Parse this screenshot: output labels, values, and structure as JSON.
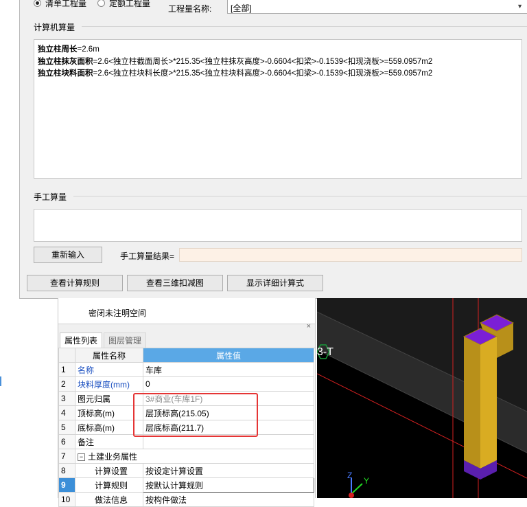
{
  "top_row": {
    "radio_bill": "清单工程量",
    "radio_quota": "定额工程量",
    "quantity_name_label": "工程量名称:",
    "quantity_name_value": "[全部]"
  },
  "computer_calc": {
    "title": "计算机算量",
    "lines": [
      {
        "bold": "独立柱周长",
        "rest": "=2.6m"
      },
      {
        "bold": "独立柱抹灰面积",
        "rest": "=2.6<独立柱截面周长>*215.35<独立柱抹灰高度>-0.6604<扣梁>-0.1539<扣现浇板>=559.0957m2"
      },
      {
        "bold": "独立柱块料面积",
        "rest": "=2.6<独立柱块料长度>*215.35<独立柱块料高度>-0.6604<扣梁>-0.1539<扣现浇板>=559.0957m2"
      }
    ]
  },
  "manual_calc": {
    "title": "手工算量",
    "reinput_button": "重新输入",
    "result_label": "手工算量结果=",
    "result_value": ""
  },
  "bottom_buttons": {
    "view_rules": "查看计算规则",
    "view_3d": "查看三维扣减图",
    "show_detail": "显示详细计算式"
  },
  "tree": {
    "item": "密闭未注明空间"
  },
  "panel": {
    "close": "×",
    "tabs": [
      "属性列表",
      "图层管理"
    ],
    "header_name": "属性名称",
    "header_value": "属性值",
    "rows": [
      {
        "num": "1",
        "name": "名称",
        "value": "车库"
      },
      {
        "num": "2",
        "name": "块料厚度(mm)",
        "value": "0"
      },
      {
        "num": "3",
        "name": "图元归属",
        "value": "3#商业(车库1F)"
      },
      {
        "num": "4",
        "name": "顶标高(m)",
        "value": "层顶标高(215.05)"
      },
      {
        "num": "5",
        "name": "底标高(m)",
        "value": "层底标高(211.7)"
      },
      {
        "num": "6",
        "name": "备注",
        "value": ""
      },
      {
        "num": "7",
        "name": "土建业务属性",
        "value": ""
      },
      {
        "num": "8",
        "name": "计算设置",
        "value": "按设定计算设置"
      },
      {
        "num": "9",
        "name": "计算规则",
        "value": "按默认计算规则"
      },
      {
        "num": "10",
        "name": "做法信息",
        "value": "按构件做法"
      }
    ]
  },
  "viewport": {
    "axis_label": "3-T",
    "axis_z": "Z",
    "axis_y": "Y"
  },
  "colors": {
    "header_blue": "#5aa8e6",
    "selected_row": "#3c8fd8",
    "highlight_red": "#e53535",
    "column_gold": "#c9a227",
    "column_top_purple": "#7b1fd6",
    "result_bg": "#fdf1e6"
  }
}
